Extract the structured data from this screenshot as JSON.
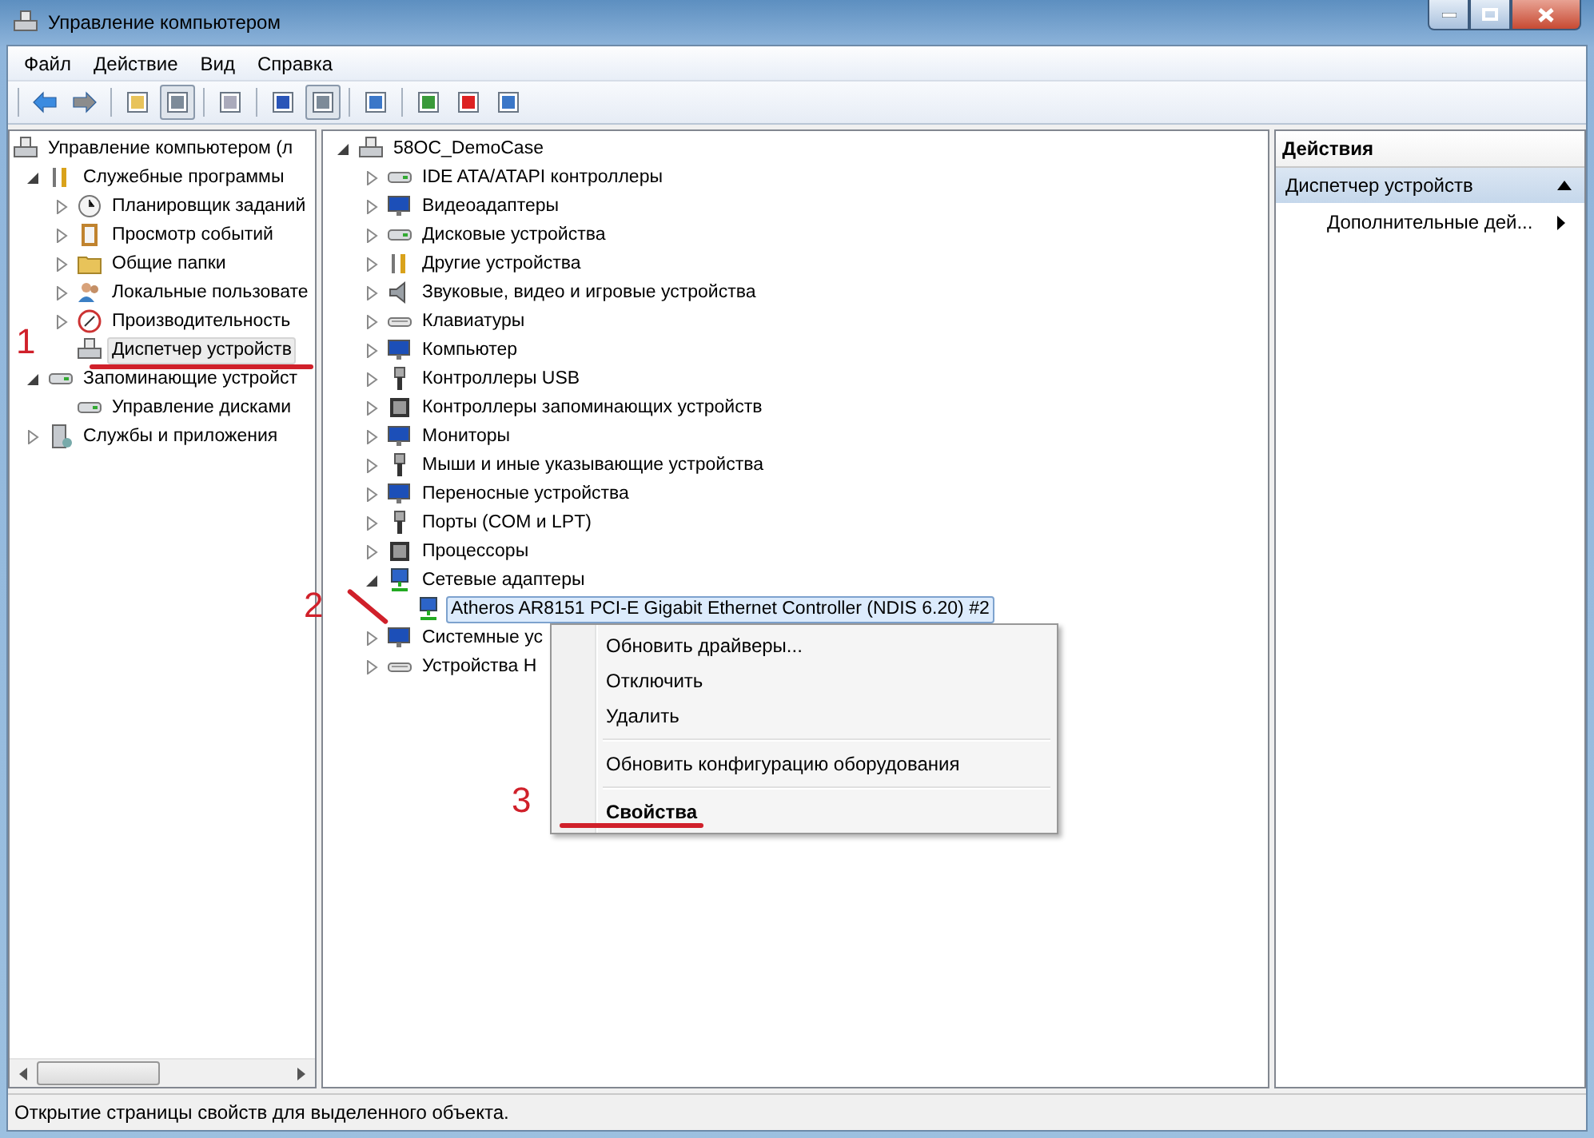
{
  "window": {
    "title": "Управление компьютером"
  },
  "menu_bar": [
    "Файл",
    "Действие",
    "Вид",
    "Справка"
  ],
  "navigation_tree": [
    {
      "label": "Управление компьютером (л",
      "kind": "root",
      "selected": false,
      "children": [
        {
          "label": "Служебные программы",
          "kind": "node",
          "expanded": true,
          "selected": false,
          "children": [
            {
              "label": "Планировщик заданий",
              "kind": "node",
              "expanded": false,
              "selected": false
            },
            {
              "label": "Просмотр событий",
              "kind": "node",
              "expanded": false,
              "selected": false
            },
            {
              "label": "Общие папки",
              "kind": "node",
              "expanded": false,
              "selected": false
            },
            {
              "label": "Локальные пользовате",
              "kind": "node",
              "expanded": false,
              "selected": false
            },
            {
              "label": "Производительность",
              "kind": "node",
              "expanded": false,
              "selected": false
            },
            {
              "label": "Диспетчер устройств",
              "kind": "leaf",
              "selected": true
            }
          ]
        },
        {
          "label": "Запоминающие устройст",
          "kind": "node",
          "expanded": true,
          "selected": false,
          "children": [
            {
              "label": "Управление дисками",
              "kind": "leaf",
              "selected": false
            }
          ]
        },
        {
          "label": "Службы и приложения",
          "kind": "node",
          "expanded": false,
          "selected": false
        }
      ]
    }
  ],
  "device_tree": [
    {
      "label": "58OC_DemoCase",
      "kind": "node",
      "expanded": true,
      "selected": false,
      "children": [
        {
          "label": "IDE ATA/ATAPI контроллеры",
          "kind": "node",
          "expanded": false,
          "selected": false
        },
        {
          "label": "Видеоадаптеры",
          "kind": "node",
          "expanded": false,
          "selected": false
        },
        {
          "label": "Дисковые устройства",
          "kind": "node",
          "expanded": false,
          "selected": false
        },
        {
          "label": "Другие устройства",
          "kind": "node",
          "expanded": false,
          "selected": false
        },
        {
          "label": "Звуковые, видео и игровые устройства",
          "kind": "node",
          "expanded": false,
          "selected": false
        },
        {
          "label": "Клавиатуры",
          "kind": "node",
          "expanded": false,
          "selected": false
        },
        {
          "label": "Компьютер",
          "kind": "node",
          "expanded": false,
          "selected": false
        },
        {
          "label": "Контроллеры USB",
          "kind": "node",
          "expanded": false,
          "selected": false
        },
        {
          "label": "Контроллеры запоминающих устройств",
          "kind": "node",
          "expanded": false,
          "selected": false
        },
        {
          "label": "Мониторы",
          "kind": "node",
          "expanded": false,
          "selected": false
        },
        {
          "label": "Мыши и иные указывающие устройства",
          "kind": "node",
          "expanded": false,
          "selected": false
        },
        {
          "label": "Переносные устройства",
          "kind": "node",
          "expanded": false,
          "selected": false
        },
        {
          "label": "Порты (COM и LPT)",
          "kind": "node",
          "expanded": false,
          "selected": false
        },
        {
          "label": "Процессоры",
          "kind": "node",
          "expanded": false,
          "selected": false
        },
        {
          "label": "Сетевые адаптеры",
          "kind": "node",
          "expanded": true,
          "selected": false,
          "children": [
            {
              "label": "Atheros AR8151 PCI-E Gigabit Ethernet Controller (NDIS 6.20) #2",
              "kind": "leaf",
              "selected": true
            }
          ]
        },
        {
          "label": "Системные ус",
          "kind": "node",
          "expanded": false,
          "selected": false
        },
        {
          "label": "Устройства H",
          "kind": "node",
          "expanded": false,
          "selected": false
        }
      ]
    }
  ],
  "actions_pane": {
    "title": "Действия",
    "section": {
      "label": "Диспетчер устройств",
      "expanded": true
    },
    "items": [
      {
        "label": "Дополнительные дей...",
        "submenu": true
      }
    ]
  },
  "context_menu": [
    {
      "kind": "item",
      "label": "Обновить драйверы...",
      "default": false
    },
    {
      "kind": "item",
      "label": "Отключить",
      "default": false
    },
    {
      "kind": "item",
      "label": "Удалить",
      "default": false
    },
    {
      "kind": "separator"
    },
    {
      "kind": "item",
      "label": "Обновить конфигурацию оборудования",
      "default": false
    },
    {
      "kind": "separator"
    },
    {
      "kind": "item",
      "label": "Свойства",
      "default": true
    }
  ],
  "status_bar": "Открытие страницы свойств для выделенного объекта.",
  "annotations": [
    "1",
    "2",
    "3"
  ]
}
